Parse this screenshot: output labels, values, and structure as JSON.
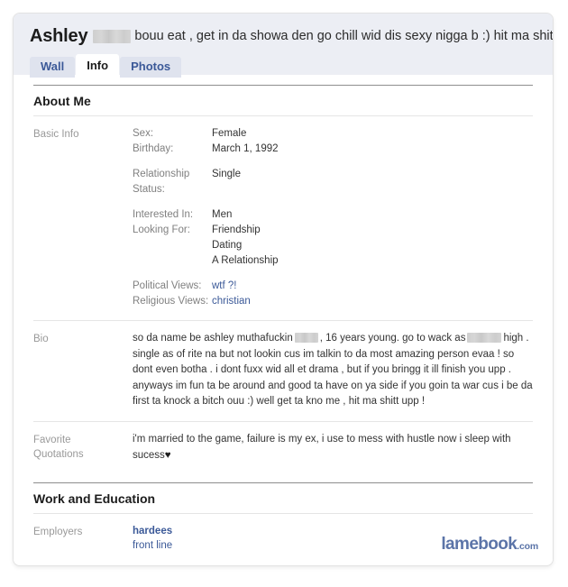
{
  "profile": {
    "name": "Ashley",
    "name_redacted": true,
    "status_text": "bouu eat , get in da showa den go chill wid dis sexy nigga b :) hit ma shitt uppp !"
  },
  "tabs": [
    {
      "label": "Wall",
      "active": false
    },
    {
      "label": "Info",
      "active": true
    },
    {
      "label": "Photos",
      "active": false
    }
  ],
  "sections": [
    {
      "heading": "About Me"
    },
    {
      "heading": "Work and Education"
    }
  ],
  "about_me": {
    "heading": "About Me",
    "basic_info": {
      "label": "Basic Info",
      "groups": [
        {
          "rows": [
            {
              "key": "Sex:",
              "values": [
                "Female"
              ],
              "link": false
            },
            {
              "key": "Birthday:",
              "values": [
                "March 1, 1992"
              ],
              "link": false
            }
          ]
        },
        {
          "rows": [
            {
              "key": "Relationship Status:",
              "values": [
                "Single"
              ],
              "link": false
            }
          ]
        },
        {
          "rows": [
            {
              "key": "Interested In:",
              "values": [
                "Men"
              ],
              "link": false
            },
            {
              "key": "Looking For:",
              "values": [
                "Friendship",
                "Dating",
                "A Relationship"
              ],
              "link": false
            }
          ]
        },
        {
          "rows": [
            {
              "key": "Political Views:",
              "values": [
                "wtf ?!"
              ],
              "link": true
            },
            {
              "key": "Religious Views:",
              "values": [
                "christian"
              ],
              "link": true
            }
          ]
        }
      ]
    },
    "bio": {
      "label": "Bio",
      "part1": "so da name be ashley muthafuckin",
      "part2": ", 16 years young. go to wack as",
      "part3": "high . single as of rite na but not lookin cus im talkin to da most amazing person evaa ! so dont even botha . i dont fuxx wid all et drama , but if you bringg it ill finish you upp . anyways im fun ta be around and good ta have on ya side if you goin ta war cus i be da first ta knock a bitch ouu :) well get ta kno me , hit ma shitt upp !"
    },
    "favorite_quotations": {
      "label": "Favorite Quotations",
      "label_line1": "Favorite",
      "label_line2": "Quotations",
      "text": "i'm married to the game, failure is my ex, i use to mess with hustle now i sleep with sucess",
      "heart": "♥"
    }
  },
  "work_and_education": {
    "heading": "Work and Education",
    "employers": {
      "label": "Employers",
      "name": "hardees",
      "position": "front line"
    }
  },
  "watermark": {
    "main": "lamebook",
    "tld": ".com"
  },
  "colors": {
    "header_band": "#eceef4",
    "tab_inactive_bg": "#dfe3ee",
    "link_blue": "#3b5998",
    "label_gray": "#999999",
    "text_dark": "#333333",
    "watermark_blue": "#5b74a8"
  }
}
